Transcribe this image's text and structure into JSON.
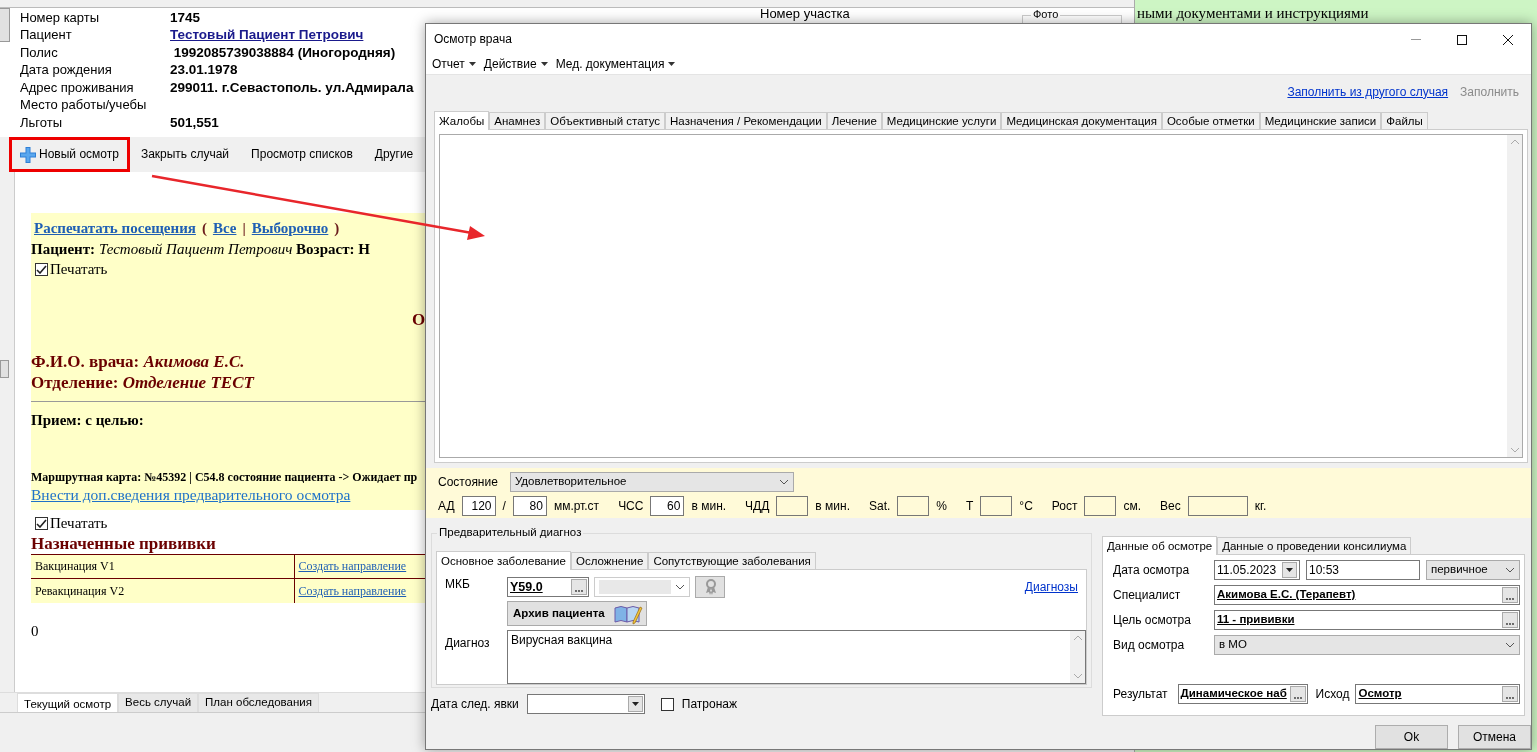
{
  "background_window": {
    "patient_info": [
      {
        "label": "Номер карты",
        "value": "1745",
        "kind": "text"
      },
      {
        "label": "Пациент",
        "value": "Тестовый Пациент Петрович",
        "kind": "link"
      },
      {
        "label": "Полис",
        "value": " 1992085739038884 (Иногородняя)",
        "kind": "text"
      },
      {
        "label": "Дата рождения",
        "value": "23.01.1978",
        "kind": "text"
      },
      {
        "label": "Адрес проживания",
        "value": "299011. г.Севастополь. ул.Адмирала",
        "kind": "text"
      },
      {
        "label": "Место работы/учебы"
      },
      {
        "label": "Льготы",
        "value": "501,551",
        "kind": "text"
      }
    ],
    "area_label": "Номер участка",
    "photo_label": "Фото",
    "toolbar": [
      {
        "label": "Новый осмотр",
        "highlighted": true,
        "kind": "add"
      },
      {
        "label": "Закрыть случай",
        "highlighted": false,
        "kind": "plain"
      },
      {
        "label": "Просмотр списков",
        "highlighted": false,
        "kind": "plain"
      },
      {
        "label": "Другие",
        "highlighted": false,
        "kind": "plain"
      }
    ],
    "report": {
      "print_link": "Распечатать посещения",
      "print_parts": [
        "(",
        "Все",
        "|",
        "Выборочно",
        ")"
      ],
      "patient_line": "**Пациент:** *Тестовый Пациент Петрович* **Возраст: Н**",
      "print_checkbox": {
        "label": "Печатать",
        "checked": true
      },
      "heading_fragment": "О",
      "doctor_line": "Ф.И.О. врача: *Акимова Е.С.*",
      "department_line": "Отделение: *Отделение ТЕСТ*",
      "purpose_line": "Прием: с целью:",
      "route_card": "Маршрутная карта: №45392 | C54.8 состояние пациента -> Ожидает пр",
      "extra_link": "Внести доп.сведения предварительного осмотра",
      "print_checkbox_2": {
        "label": "Печатать",
        "checked": true
      },
      "vaccinations_title": "Назначенные прививки",
      "vaccinations": [
        {
          "name": "Вакцинация V1",
          "action": "Создать направление"
        },
        {
          "name": "Ревакцинация V2",
          "action": "Создать направление"
        }
      ],
      "footer_value": "0"
    },
    "bottom_tabs": [
      {
        "label": "Текущий осмотр",
        "selected": true
      },
      {
        "label": "Весь случай",
        "selected": false
      },
      {
        "label": "План обследования",
        "selected": false
      }
    ]
  },
  "side_text": "ными документами и инструкциями",
  "dialog": {
    "title": "Осмотр врача",
    "menu": [
      "Отчет",
      "Действие",
      "Мед. документация"
    ],
    "links": [
      {
        "label": "Заполнить из другого случая",
        "disabled": false
      },
      {
        "label": "Заполнить",
        "disabled": true
      }
    ],
    "tabs": [
      {
        "label": "Жалобы",
        "selected": true
      },
      {
        "label": "Анамнез",
        "selected": false
      },
      {
        "label": "Объективный статус",
        "selected": false
      },
      {
        "label": "Назначения / Рекомендации",
        "selected": false
      },
      {
        "label": "Лечение",
        "selected": false
      },
      {
        "label": "Медицинские услуги",
        "selected": false
      },
      {
        "label": "Медицинская документация",
        "selected": false
      },
      {
        "label": "Особые отметки",
        "selected": false
      },
      {
        "label": "Медицинские записи",
        "selected": false
      },
      {
        "label": "Файлы",
        "selected": false
      }
    ],
    "condition": {
      "label": "Состояние",
      "value": "Удовлетворительное"
    },
    "vitals": [
      {
        "label": "АД",
        "value": "120",
        "unit": "/"
      },
      {
        "value": "80",
        "unit": "мм.рт.ст"
      },
      {
        "label": "ЧСС",
        "value": "60",
        "unit": "в мин."
      },
      {
        "label": "ЧДД",
        "unit": "в мин."
      },
      {
        "label": "Sat.",
        "unit": "%"
      },
      {
        "label": "T",
        "unit": "°C"
      },
      {
        "label": "Рост",
        "unit": "см."
      },
      {
        "label": "Вес",
        "unit": "кг."
      }
    ],
    "diagnosis_group": {
      "legend": "Предварительный диагноз",
      "tabs": [
        {
          "label": "Основное заболевание",
          "selected": true
        },
        {
          "label": "Осложнение",
          "selected": false
        },
        {
          "label": "Сопутствующие заболевания",
          "selected": false
        }
      ],
      "mkb_label": "МКБ",
      "mkb_code": "Y59.0",
      "diagnoses_link": "Диагнозы",
      "archive_button": "Архив пациента",
      "diagnosis_label": "Диагноз",
      "diagnosis_text": "Вирусная вакцина"
    },
    "next_visit": {
      "label": "Дата след. явки"
    },
    "patronage": {
      "label": "Патронаж",
      "checked": false
    },
    "exam_tabs": [
      {
        "label": "Данные об осмотре",
        "selected": true
      },
      {
        "label": "Данные о проведении консилиума",
        "selected": false
      }
    ],
    "exam": {
      "date_label": "Дата осмотра",
      "date": "11.05.2023",
      "time": "10:53",
      "visit_type": "первичное",
      "specialist_label": "Специалист",
      "specialist": "Акимова Е.С. (Терапевт)",
      "purpose_label": "Цель осмотра",
      "purpose": "11 - прививки",
      "kind_label": "Вид осмотра",
      "kind_value": "в МО",
      "result_label": "Результат",
      "result": "Динамическое наб",
      "outcome_label": "Исход",
      "outcome": "Осмотр"
    },
    "buttons": [
      "Ok",
      "Отмена"
    ]
  }
}
